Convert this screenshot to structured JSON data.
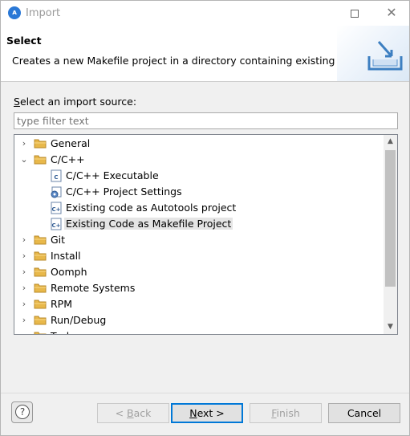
{
  "window": {
    "title": "Import",
    "app_icon": "eclipse-icon"
  },
  "header": {
    "title": "Select",
    "description": "Creates a new Makefile project in a directory containing existing code"
  },
  "source": {
    "label_mnemonic": "S",
    "label_rest": "elect an import source:",
    "filter_placeholder": "type filter text"
  },
  "tree": {
    "items": [
      {
        "label": "General",
        "level": 0,
        "type": "folder",
        "expanded": false
      },
      {
        "label": "C/C++",
        "level": 0,
        "type": "folder",
        "expanded": true
      },
      {
        "label": "C/C++ Executable",
        "level": 1,
        "type": "c-executable-icon"
      },
      {
        "label": "C/C++ Project Settings",
        "level": 1,
        "type": "project-settings-icon"
      },
      {
        "label": "Existing code as Autotools project",
        "level": 1,
        "type": "cpp-file-icon"
      },
      {
        "label": "Existing Code as Makefile Project",
        "level": 1,
        "type": "cpp-file-icon",
        "selected": true
      },
      {
        "label": "Git",
        "level": 0,
        "type": "folder",
        "expanded": false
      },
      {
        "label": "Install",
        "level": 0,
        "type": "folder",
        "expanded": false
      },
      {
        "label": "Oomph",
        "level": 0,
        "type": "folder",
        "expanded": false
      },
      {
        "label": "Remote Systems",
        "level": 0,
        "type": "folder",
        "expanded": false
      },
      {
        "label": "RPM",
        "level": 0,
        "type": "folder",
        "expanded": false
      },
      {
        "label": "Run/Debug",
        "level": 0,
        "type": "folder",
        "expanded": false
      },
      {
        "label": "Tasks",
        "level": 0,
        "type": "folder",
        "expanded": false
      }
    ]
  },
  "buttons": {
    "help": "?",
    "back_prefix": "< ",
    "back_mnemonic": "B",
    "back_rest": "ack",
    "next_mnemonic": "N",
    "next_rest": "ext >",
    "finish_mnemonic": "F",
    "finish_rest": "inish",
    "cancel": "Cancel"
  },
  "colors": {
    "accent": "#0078d7",
    "folder": "#e8b84a",
    "selected_bg": "#e5e5e5"
  }
}
